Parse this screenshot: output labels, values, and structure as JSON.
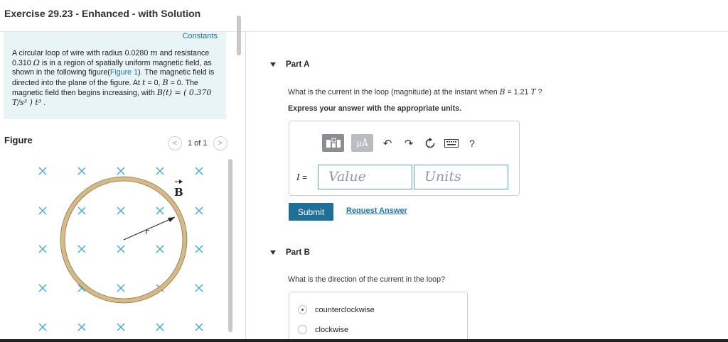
{
  "header": {
    "title": "Exercise 29.23 - Enhanced - with Solution"
  },
  "problem": {
    "constants_link": "Constants",
    "text_1": "A circular loop of wire with radius 0.0280 ",
    "unit_m": "m",
    "text_2": " and resistance 0.310 ",
    "unit_ohm": "Ω",
    "text_3": " is in a region of spatially uniform magnetic field, as shown in the following figure(",
    "figure_link": "Figure 1",
    "text_4": "). The magnetic field is directed into the plane of the figure. At ",
    "var_t": "t",
    "text_5": " = 0, ",
    "var_B": "B",
    "text_6": " = 0. The magnetic field then begins increasing, with ",
    "formula": "B(t) = ( 0.370 T/s³ ) t³",
    "text_7": " ."
  },
  "figure": {
    "label": "Figure",
    "pager_prev": "<",
    "pager_text": "1 of 1",
    "pager_next": ">",
    "field_label": "B",
    "radius_label": "r",
    "ring_color": "#d7b985",
    "x_color": "#3aa9d4"
  },
  "partA": {
    "title": "Part A",
    "question_1": "What is the current in the loop (magnitude) at the instant when ",
    "question_var": "B",
    "question_2": " = 1.21 ",
    "question_unit": "T",
    "question_3": " ?",
    "express": "Express your answer with the appropriate units.",
    "toolbar": {
      "templates_icon": "templates-icon",
      "units_button": "μÅ",
      "undo_icon": "undo-icon",
      "redo_icon": "redo-icon",
      "reset_icon": "reset-icon",
      "keyboard_icon": "keyboard-icon",
      "help": "?"
    },
    "variable": "I",
    "equals": "=",
    "value_placeholder": "Value",
    "units_placeholder": "Units",
    "submit": "Submit",
    "request_answer": "Request Answer"
  },
  "partB": {
    "title": "Part B",
    "question": "What is the direction of the current in the loop?",
    "options": [
      "counterclockwise",
      "clockwise"
    ]
  }
}
